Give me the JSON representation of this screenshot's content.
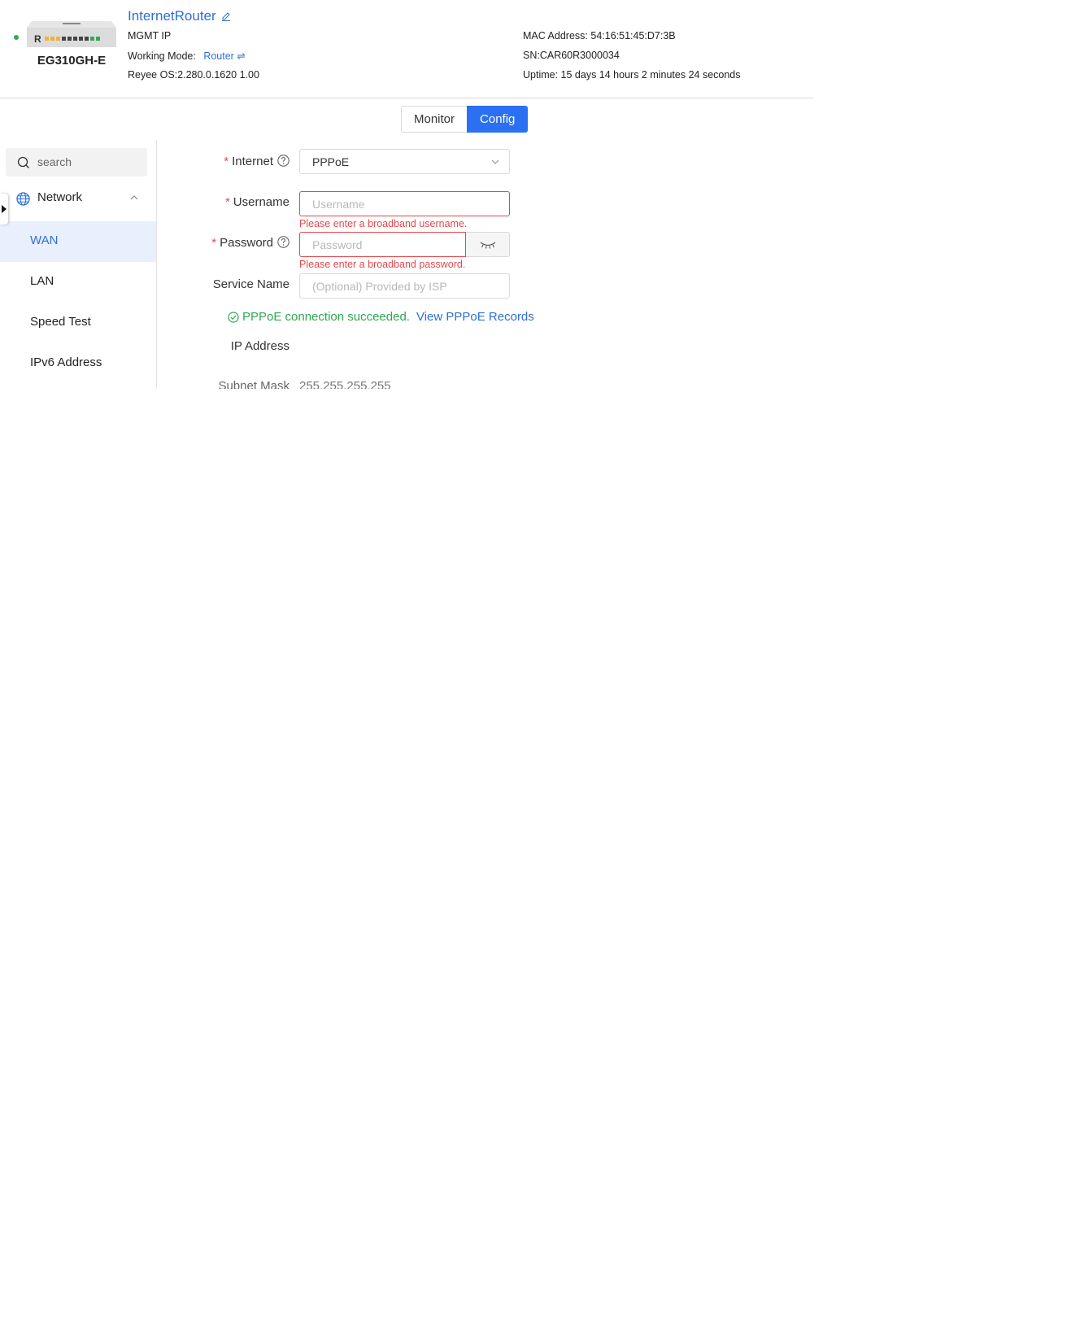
{
  "device": {
    "name": "InternetRouter",
    "model": "EG310GH-E",
    "mgmt_ip_label": "MGMT IP",
    "working_mode_label": "Working Mode:",
    "working_mode_value": "Router",
    "os": "Reyee OS:2.280.0.1620 1.00",
    "mac": "MAC Address: 54:16:51:45:D7:3B",
    "sn": "SN:CAR60R3000034",
    "uptime": "Uptime: 15 days 14 hours 2 minutes 24 seconds",
    "status_color": "#2fa84f"
  },
  "tabs": [
    {
      "label": "Monitor",
      "active": false
    },
    {
      "label": "Config",
      "active": true
    }
  ],
  "sidebar": {
    "search_placeholder": "search",
    "group": {
      "label": "Network",
      "icon": "globe-icon"
    },
    "items": [
      {
        "label": "WAN",
        "active": true
      },
      {
        "label": "LAN",
        "active": false
      },
      {
        "label": "Speed Test",
        "active": false
      },
      {
        "label": "IPv6 Address",
        "active": false
      }
    ]
  },
  "form": {
    "required_mark": "*",
    "internet": {
      "label": "Internet",
      "value": "PPPoE"
    },
    "username": {
      "label": "Username",
      "placeholder": "Username",
      "value": "",
      "error": "Please enter a broadband username."
    },
    "password": {
      "label": "Password",
      "placeholder": "Password",
      "value": "",
      "error": "Please enter a broadband password."
    },
    "service_name": {
      "label": "Service Name",
      "placeholder": "(Optional) Provided by ISP",
      "value": ""
    },
    "status": {
      "text": "PPPoE connection succeeded.",
      "link": "View PPPoE Records"
    },
    "ip_address": {
      "label": "IP Address",
      "value": ""
    },
    "subnet_mask": {
      "label": "Subnet Mask",
      "value": "255.255.255.255"
    }
  },
  "colors": {
    "accent": "#2b6ff2",
    "link": "#2f6fd6",
    "error": "#e5484d",
    "success": "#2fa84f"
  }
}
